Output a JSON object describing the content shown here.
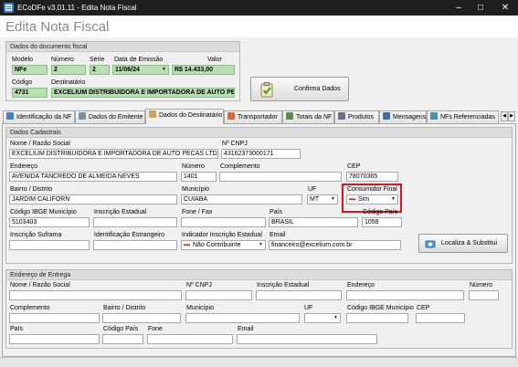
{
  "window": {
    "title": "ECoDFe v3.01.11 - Edita Nota Fiscal",
    "minimize": "–",
    "maximize": "□",
    "close": "✕"
  },
  "header": {
    "title": "Edita Nota Fiscal"
  },
  "doc_group": {
    "title": "Dados do documento fiscal",
    "modelo_label": "Modelo",
    "modelo": "NFe",
    "numero_label": "Número",
    "numero": "2",
    "serie_label": "Série",
    "serie": "2",
    "data_label": "Data de Emissão",
    "data": "11/06/24",
    "valor_label": "Valor",
    "valor": "R$ 14.433,00",
    "codigo_label": "Código",
    "codigo": "4731",
    "destinatario_label": "Destinatário",
    "destinatario": "EXCELIUM DISTRIBUIDORA E IMPORTADORA DE AUTO PEÇ"
  },
  "confirm_button": {
    "label": "Confirma Dados"
  },
  "tabs": [
    {
      "label": "Identificação da NF"
    },
    {
      "label": "Dados do Emitente"
    },
    {
      "label": "Dados do Destinatário"
    },
    {
      "label": "Transportador"
    },
    {
      "label": "Totais da NF"
    },
    {
      "label": "Produtos"
    },
    {
      "label": "Mensagens"
    },
    {
      "label": "NFs Referenciadas"
    }
  ],
  "cadastrais": {
    "title": "Dados Cadastrais",
    "nome_label": "Nome / Razão Social",
    "nome": "EXCELIUM DISTRIBUIDORA E IMPORTADORA DE AUTO PECAS LTDA",
    "cnpj_label": "Nº CNPJ",
    "cnpj": "43162373000171",
    "endereco_label": "Endereço",
    "endereco": "AVENIDA TANCREDO DE ALMEIDA NEVES",
    "numero_label": "Número",
    "numero": "1401",
    "complemento_label": "Complemento",
    "complemento": "",
    "cep_label": "CEP",
    "cep": "78070365",
    "bairro_label": "Bairro / Distrito",
    "bairro": "JARDIM CALIFORN",
    "municipio_label": "Município",
    "municipio": "CUIABA",
    "uf_label": "UF",
    "uf": "MT",
    "consumidor_label": "Consumidor Final",
    "consumidor": "Sim",
    "ibge_label": "Código IBGE Município",
    "ibge": "5103403",
    "ie_label": "Inscrição Estadual",
    "ie": "",
    "fone_label": "Fone / Fax",
    "fone": "",
    "pais_label": "País",
    "pais": "BRASIL",
    "codpais_label": "Código País",
    "codpais": "1058",
    "suframa_label": "Inscrição Suframa",
    "suframa": "",
    "idestr_label": "Identificação Estrangeiro",
    "idestr": "",
    "indicador_label": "Indicador Inscrição Estadual",
    "indicador": "Não Contribuinte",
    "email_label": "Email",
    "email": "financeiro@excelium.com.br"
  },
  "localiza_button": {
    "label": "Localiza & Substitui"
  },
  "entrega": {
    "title": "Endereço de Entrega",
    "nome_label": "Nome / Razão Social",
    "cnpj_label": "Nº CNPJ",
    "ie_label": "Inscrição Estadual",
    "endereco_label": "Endereço",
    "numero_label": "Número",
    "complemento_label": "Complemento",
    "bairro_label": "Bairro / Distrito",
    "municipio_label": "Município",
    "uf_label": "UF",
    "ibge_label": "Código IBGE Município",
    "cep_label": "CEP",
    "pais_label": "País",
    "codpais_label": "Código País",
    "fone_label": "Fone",
    "email_label": "Email"
  },
  "colors": {
    "highlight": "#e0141e",
    "readonly_field": "#b7e0b0",
    "titlebar": "#1f1f1f"
  }
}
